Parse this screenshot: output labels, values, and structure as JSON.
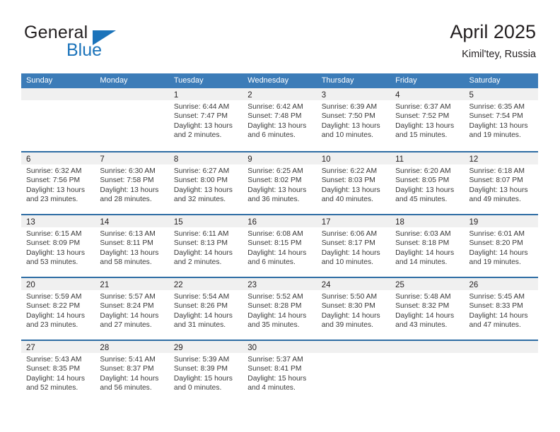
{
  "brand": {
    "name_dark": "General",
    "name_blue": "Blue",
    "accent_color": "#1b73ba"
  },
  "header": {
    "title": "April 2025",
    "subtitle": "Kimil'tey, Russia"
  },
  "colors": {
    "header_row_bg": "#3c7cb8",
    "week_divider": "#2e6da4",
    "day_number_band": "#f0f0f0",
    "text": "#231f20"
  },
  "weekdays": [
    "Sunday",
    "Monday",
    "Tuesday",
    "Wednesday",
    "Thursday",
    "Friday",
    "Saturday"
  ],
  "weeks": [
    [
      {
        "day": "",
        "lines": []
      },
      {
        "day": "",
        "lines": []
      },
      {
        "day": "1",
        "lines": [
          "Sunrise: 6:44 AM",
          "Sunset: 7:47 PM",
          "Daylight: 13 hours",
          "and 2 minutes."
        ]
      },
      {
        "day": "2",
        "lines": [
          "Sunrise: 6:42 AM",
          "Sunset: 7:48 PM",
          "Daylight: 13 hours",
          "and 6 minutes."
        ]
      },
      {
        "day": "3",
        "lines": [
          "Sunrise: 6:39 AM",
          "Sunset: 7:50 PM",
          "Daylight: 13 hours",
          "and 10 minutes."
        ]
      },
      {
        "day": "4",
        "lines": [
          "Sunrise: 6:37 AM",
          "Sunset: 7:52 PM",
          "Daylight: 13 hours",
          "and 15 minutes."
        ]
      },
      {
        "day": "5",
        "lines": [
          "Sunrise: 6:35 AM",
          "Sunset: 7:54 PM",
          "Daylight: 13 hours",
          "and 19 minutes."
        ]
      }
    ],
    [
      {
        "day": "6",
        "lines": [
          "Sunrise: 6:32 AM",
          "Sunset: 7:56 PM",
          "Daylight: 13 hours",
          "and 23 minutes."
        ]
      },
      {
        "day": "7",
        "lines": [
          "Sunrise: 6:30 AM",
          "Sunset: 7:58 PM",
          "Daylight: 13 hours",
          "and 28 minutes."
        ]
      },
      {
        "day": "8",
        "lines": [
          "Sunrise: 6:27 AM",
          "Sunset: 8:00 PM",
          "Daylight: 13 hours",
          "and 32 minutes."
        ]
      },
      {
        "day": "9",
        "lines": [
          "Sunrise: 6:25 AM",
          "Sunset: 8:02 PM",
          "Daylight: 13 hours",
          "and 36 minutes."
        ]
      },
      {
        "day": "10",
        "lines": [
          "Sunrise: 6:22 AM",
          "Sunset: 8:03 PM",
          "Daylight: 13 hours",
          "and 40 minutes."
        ]
      },
      {
        "day": "11",
        "lines": [
          "Sunrise: 6:20 AM",
          "Sunset: 8:05 PM",
          "Daylight: 13 hours",
          "and 45 minutes."
        ]
      },
      {
        "day": "12",
        "lines": [
          "Sunrise: 6:18 AM",
          "Sunset: 8:07 PM",
          "Daylight: 13 hours",
          "and 49 minutes."
        ]
      }
    ],
    [
      {
        "day": "13",
        "lines": [
          "Sunrise: 6:15 AM",
          "Sunset: 8:09 PM",
          "Daylight: 13 hours",
          "and 53 minutes."
        ]
      },
      {
        "day": "14",
        "lines": [
          "Sunrise: 6:13 AM",
          "Sunset: 8:11 PM",
          "Daylight: 13 hours",
          "and 58 minutes."
        ]
      },
      {
        "day": "15",
        "lines": [
          "Sunrise: 6:11 AM",
          "Sunset: 8:13 PM",
          "Daylight: 14 hours",
          "and 2 minutes."
        ]
      },
      {
        "day": "16",
        "lines": [
          "Sunrise: 6:08 AM",
          "Sunset: 8:15 PM",
          "Daylight: 14 hours",
          "and 6 minutes."
        ]
      },
      {
        "day": "17",
        "lines": [
          "Sunrise: 6:06 AM",
          "Sunset: 8:17 PM",
          "Daylight: 14 hours",
          "and 10 minutes."
        ]
      },
      {
        "day": "18",
        "lines": [
          "Sunrise: 6:03 AM",
          "Sunset: 8:18 PM",
          "Daylight: 14 hours",
          "and 14 minutes."
        ]
      },
      {
        "day": "19",
        "lines": [
          "Sunrise: 6:01 AM",
          "Sunset: 8:20 PM",
          "Daylight: 14 hours",
          "and 19 minutes."
        ]
      }
    ],
    [
      {
        "day": "20",
        "lines": [
          "Sunrise: 5:59 AM",
          "Sunset: 8:22 PM",
          "Daylight: 14 hours",
          "and 23 minutes."
        ]
      },
      {
        "day": "21",
        "lines": [
          "Sunrise: 5:57 AM",
          "Sunset: 8:24 PM",
          "Daylight: 14 hours",
          "and 27 minutes."
        ]
      },
      {
        "day": "22",
        "lines": [
          "Sunrise: 5:54 AM",
          "Sunset: 8:26 PM",
          "Daylight: 14 hours",
          "and 31 minutes."
        ]
      },
      {
        "day": "23",
        "lines": [
          "Sunrise: 5:52 AM",
          "Sunset: 8:28 PM",
          "Daylight: 14 hours",
          "and 35 minutes."
        ]
      },
      {
        "day": "24",
        "lines": [
          "Sunrise: 5:50 AM",
          "Sunset: 8:30 PM",
          "Daylight: 14 hours",
          "and 39 minutes."
        ]
      },
      {
        "day": "25",
        "lines": [
          "Sunrise: 5:48 AM",
          "Sunset: 8:32 PM",
          "Daylight: 14 hours",
          "and 43 minutes."
        ]
      },
      {
        "day": "26",
        "lines": [
          "Sunrise: 5:45 AM",
          "Sunset: 8:33 PM",
          "Daylight: 14 hours",
          "and 47 minutes."
        ]
      }
    ],
    [
      {
        "day": "27",
        "lines": [
          "Sunrise: 5:43 AM",
          "Sunset: 8:35 PM",
          "Daylight: 14 hours",
          "and 52 minutes."
        ]
      },
      {
        "day": "28",
        "lines": [
          "Sunrise: 5:41 AM",
          "Sunset: 8:37 PM",
          "Daylight: 14 hours",
          "and 56 minutes."
        ]
      },
      {
        "day": "29",
        "lines": [
          "Sunrise: 5:39 AM",
          "Sunset: 8:39 PM",
          "Daylight: 15 hours",
          "and 0 minutes."
        ]
      },
      {
        "day": "30",
        "lines": [
          "Sunrise: 5:37 AM",
          "Sunset: 8:41 PM",
          "Daylight: 15 hours",
          "and 4 minutes."
        ]
      },
      {
        "day": "",
        "lines": []
      },
      {
        "day": "",
        "lines": []
      },
      {
        "day": "",
        "lines": []
      }
    ]
  ]
}
